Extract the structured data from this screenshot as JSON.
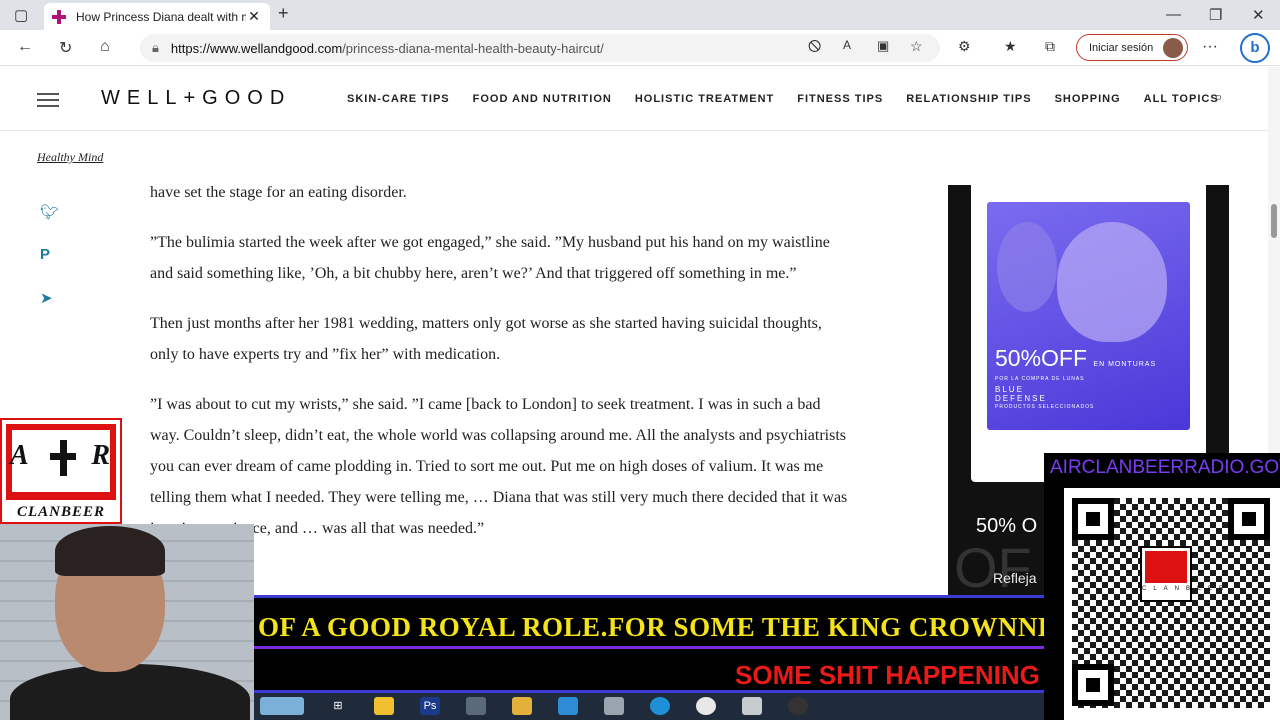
{
  "browser": {
    "tab_title": "How Princess Diana dealt with m",
    "tab_close": "✕",
    "new_tab": "+",
    "window_min": "—",
    "window_max": "❐",
    "window_close": "✕",
    "url_host": "https://www.wellandgood.com",
    "url_path": "/princess-diana-mental-health-beauty-haircut/",
    "signin_label": "Iniciar sesión",
    "more": "···",
    "bing": "b"
  },
  "site": {
    "logo": "WELL+GOOD",
    "nav": [
      "SKIN-CARE TIPS",
      "FOOD AND NUTRITION",
      "HOLISTIC TREATMENT",
      "FITNESS TIPS",
      "RELATIONSHIP TIPS",
      "SHOPPING",
      "ALL TOPICS"
    ],
    "breadcrumb": "Healthy Mind"
  },
  "article": {
    "p1": "have set the stage for an eating disorder.",
    "p2": "”The bulimia started the week after we got engaged,” she said. ”My husband put his hand on my waistline and said something like, ’Oh, a bit chubby here, aren’t we?’ And that triggered off something in me.”",
    "p3": "Then just months after her 1981 wedding, matters only got worse as she started having suicidal thoughts, only to have experts try and ”fix her” with medication.",
    "p4": "”I was about to cut my wrists,” she said. ”I came [back to London] to seek treatment. I was in such a bad way. Couldn’t sleep, didn’t eat, the whole world was collapsing around me. All the analysts and psychiatrists you can ever dream of came plodding in. Tried to sort me out. Put me on high doses of valium. It was me telling them what I needed. They were telling me, … Diana that was still very much there decided that it was just time, patience, and … was all that was needed.”"
  },
  "ad": {
    "headline": "50%OFF",
    "headline_small": "EN MONTURAS",
    "subline": "POR LA COMPRA DE LUNAS",
    "brand_line1": "BLUE",
    "brand_line2": "DEFENSE",
    "brand_line3": "PRODUCTOS SELECCIONADOS",
    "lower_offer": "50% O",
    "lower_text": "Refleja",
    "lower_ghost": "OF"
  },
  "overlay": {
    "badge_left": "A",
    "badge_right": "R",
    "badge_caption": "CLANBEER",
    "ticker_line1": "OF A GOOD ROYAL ROLE.FOR SOME THE KING CROWNNED",
    "ticker_line2": "SOME SHIT HAPPENING",
    "qr_url": "AIRCLANBEERRADIO.GOV",
    "qr_logo_text": "CLANBEER"
  },
  "colors": {
    "ticker_yellow": "#f4e21a",
    "ticker_red": "#e81a1a",
    "ticker_border": "#3a3ad6",
    "share_blue": "#1b7ba0",
    "ad_purple": "#5a45e0"
  }
}
